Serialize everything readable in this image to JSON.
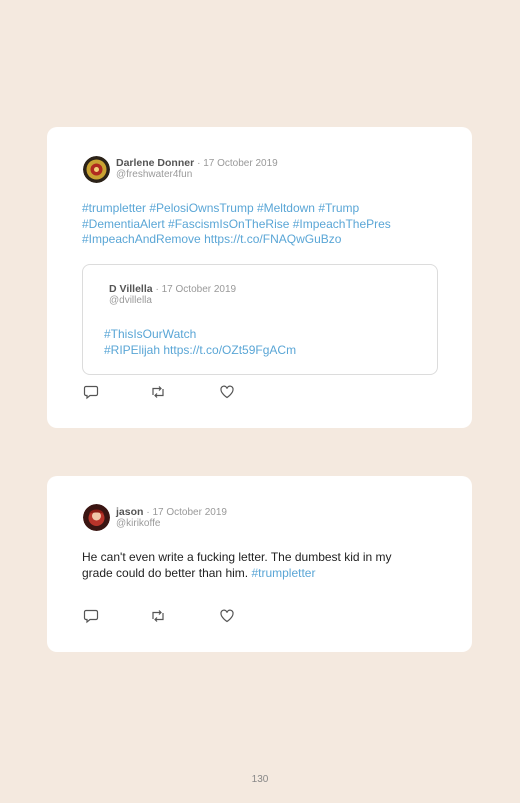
{
  "tweets": [
    {
      "author": "Darlene Donner",
      "date": "· 17 October 2019",
      "handle": "@freshwater4fun",
      "lines": [
        "#trumpletter #PelosiOwnsTrump #Meltdown #Trump",
        "#DementiaAlert #FascismIsOnTheRise #ImpeachThePres",
        "#ImpeachAndRemove https://t.co/FNAQwGuBzo"
      ],
      "quoted": {
        "author": "D Villella",
        "date": "· 17 October 2019",
        "handle": "@dvillella",
        "lines": [
          "#ThisIsOurWatch",
          "#RIPElijah https://t.co/OZt59FgACm"
        ]
      }
    },
    {
      "author": "jason",
      "date": "· 17 October 2019",
      "handle": "@kirikoffe",
      "line1": "He can't even write a fucking letter. The dumbest kid in my",
      "line2_text": "grade could do better than him.",
      "line2_tag": "#trumpletter"
    }
  ],
  "icons": [
    "reply-icon",
    "retweet-icon",
    "like-icon"
  ],
  "colors": {
    "link": "#5aa6d6",
    "background": "#f4e9df",
    "card": "#ffffff"
  },
  "page_number": "130"
}
